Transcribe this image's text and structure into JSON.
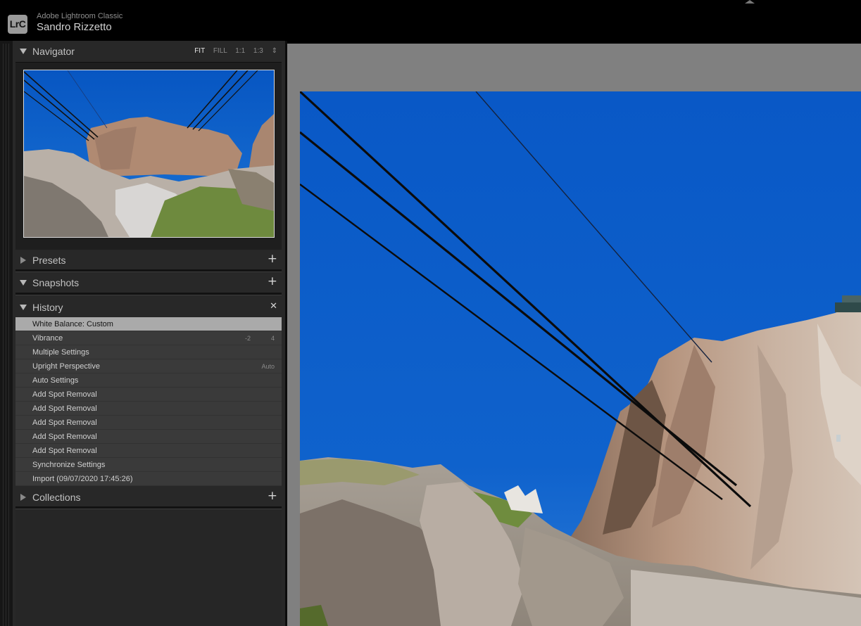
{
  "app": {
    "logo_text": "LrC",
    "name": "Adobe Lightroom Classic",
    "user": "Sandro Rizzetto"
  },
  "navigator": {
    "title": "Navigator",
    "zoom_options": [
      "FIT",
      "FILL",
      "1:1",
      "1:3"
    ],
    "active_zoom": "FIT",
    "zoom_stepper": "⇕"
  },
  "presets": {
    "title": "Presets",
    "add_icon": "+"
  },
  "snapshots": {
    "title": "Snapshots",
    "add_icon": "+"
  },
  "history": {
    "title": "History",
    "clear_icon": "✕",
    "items": [
      {
        "label": "White Balance: Custom",
        "v1": "",
        "v2": ""
      },
      {
        "label": "Vibrance",
        "v1": "-2",
        "v2": "4"
      },
      {
        "label": "Multiple Settings",
        "v1": "",
        "v2": ""
      },
      {
        "label": "Upright Perspective",
        "v1": "",
        "v2": "Auto"
      },
      {
        "label": "Auto Settings",
        "v1": "",
        "v2": ""
      },
      {
        "label": "Add Spot Removal",
        "v1": "",
        "v2": ""
      },
      {
        "label": "Add Spot Removal",
        "v1": "",
        "v2": ""
      },
      {
        "label": "Add Spot Removal",
        "v1": "",
        "v2": ""
      },
      {
        "label": "Add Spot Removal",
        "v1": "",
        "v2": ""
      },
      {
        "label": "Add Spot Removal",
        "v1": "",
        "v2": ""
      },
      {
        "label": "Synchronize Settings",
        "v1": "",
        "v2": ""
      },
      {
        "label": "Import (09/07/2020 17:45:26)",
        "v1": "",
        "v2": ""
      }
    ]
  },
  "collections": {
    "title": "Collections",
    "add_icon": "+"
  },
  "colors": {
    "sky": "#0a63c9",
    "rock_light": "#c2b4a6",
    "rock_warm": "#b48c70",
    "grass": "#6e8e3c",
    "selected_row": "#aaaaaa"
  }
}
